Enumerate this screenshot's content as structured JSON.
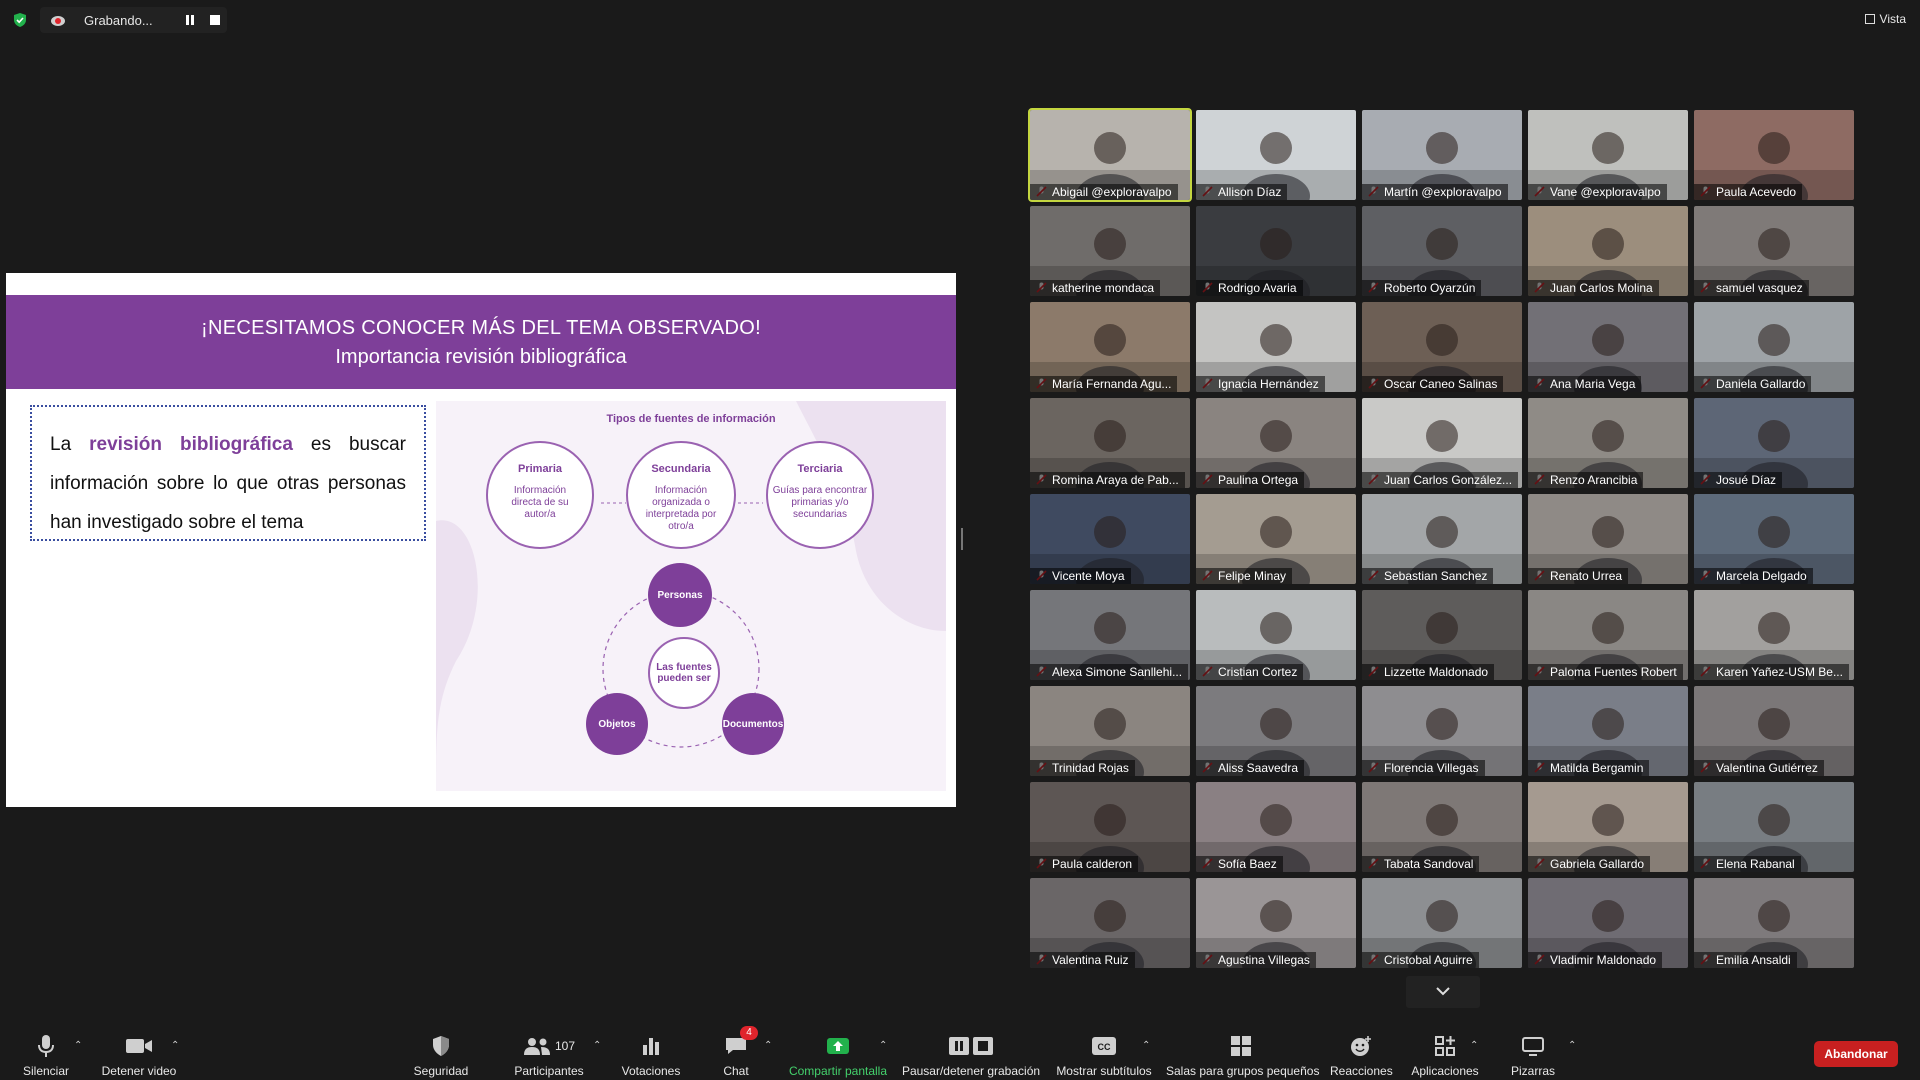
{
  "topbar": {
    "recording_text": "Grabando...",
    "view_label": "Vista"
  },
  "slide": {
    "title": "¡NECESITAMOS CONOCER MÁS DEL TEMA OBSERVADO!",
    "subtitle": "Importancia revisión bibliográfica",
    "text_pre": "La ",
    "text_highlight": "revisión bibliográfica",
    "text_post": " es buscar información sobre lo que otras personas han investigado sobre el tema",
    "diagram": {
      "heading": "Tipos de fuentes de información",
      "types": [
        {
          "label": "Primaria",
          "desc": "Información directa de su autor/a"
        },
        {
          "label": "Secundaria",
          "desc": "Información organizada o interpretada por otro/a"
        },
        {
          "label": "Terciaria",
          "desc": "Guías para encontrar primarias y/o secundarias"
        }
      ],
      "center": "Las fuentes pueden ser",
      "nodes": [
        "Personas",
        "Objetos",
        "Documentos"
      ]
    }
  },
  "participants": [
    "Abigail @exploravalpo",
    "Allison Díaz",
    "Martín @exploravalpo",
    "Vane @exploravalpo",
    "Paula Acevedo",
    "katherine mondaca",
    "Rodrigo Avaria",
    "Roberto Oyarzún",
    "Juan Carlos Molina",
    "samuel vasquez",
    "María Fernanda Agu...",
    "Ignacia Hernández",
    "Oscar Caneo Salinas",
    "Ana Maria Vega",
    "Daniela Gallardo",
    "Romina Araya de Pab...",
    "Paulina Ortega",
    "Juan Carlos González...",
    "Renzo Arancibia",
    "Josué Díaz",
    "Vicente Moya",
    "Felipe Minay",
    "Sebastian Sanchez",
    "Renato Urrea",
    "Marcela Delgado",
    "Alexa Simone Sanllehi...",
    "Cristian Cortez",
    "Lizzette Maldonado",
    "Paloma Fuentes Robert",
    "Karen Yañez-USM Be...",
    "Trinidad Rojas",
    "Aliss Saavedra",
    "Florencia Villegas",
    "Matilda Bergamin",
    "Valentina Gutiérrez",
    "Paula calderon",
    "Sofía Baez",
    "Tabata Sandoval",
    "Gabriela Gallardo",
    "Elena Rabanal",
    "Valentina Ruiz",
    "Agustina Villegas",
    "Cristobal Aguirre",
    "Vladimir Maldonado",
    "Emilia Ansaldi"
  ],
  "tile_colors": [
    "#b7b3ad",
    "#cfd3d6",
    "#a8acb2",
    "#bfc0bd",
    "#8e6b63",
    "#6f6c6a",
    "#3a3c40",
    "#5e5f63",
    "#9c8e7d",
    "#7f7a78",
    "#8c7a6a",
    "#c4c4c2",
    "#6d5f55",
    "#727076",
    "#9ea3a7",
    "#6b6560",
    "#8a8480",
    "#c9c9c7",
    "#8f8b86",
    "#5d6676",
    "#3f4a60",
    "#a49c91",
    "#a3a6a8",
    "#8f8a86",
    "#5d6a7a",
    "#75767a",
    "#b9bcbd",
    "#5e5c5b",
    "#8a8784",
    "#a2a09e",
    "#8b8580",
    "#7c7b7e",
    "#8e8d90",
    "#7a7e88",
    "#7b7778",
    "#5d5654",
    "#8a8083",
    "#7e7876",
    "#a59a90",
    "#787d82",
    "#6a6667",
    "#9a9596",
    "#8d8f92",
    "#6f6c73",
    "#7e7a7c"
  ],
  "toolbar": {
    "mute": "Silenciar",
    "stop_video": "Detener video",
    "security": "Seguridad",
    "participants": "Participantes",
    "participants_count": "107",
    "polls": "Votaciones",
    "chat": "Chat",
    "chat_badge": "4",
    "share": "Compartir pantalla",
    "pause_rec": "Pausar/detener grabación",
    "captions": "Mostrar subtítulos",
    "captions_icon": "CC",
    "breakout": "Salas para grupos pequeños",
    "reactions": "Reacciones",
    "apps": "Aplicaciones",
    "whiteboards": "Pizarras",
    "leave": "Abandonar"
  }
}
